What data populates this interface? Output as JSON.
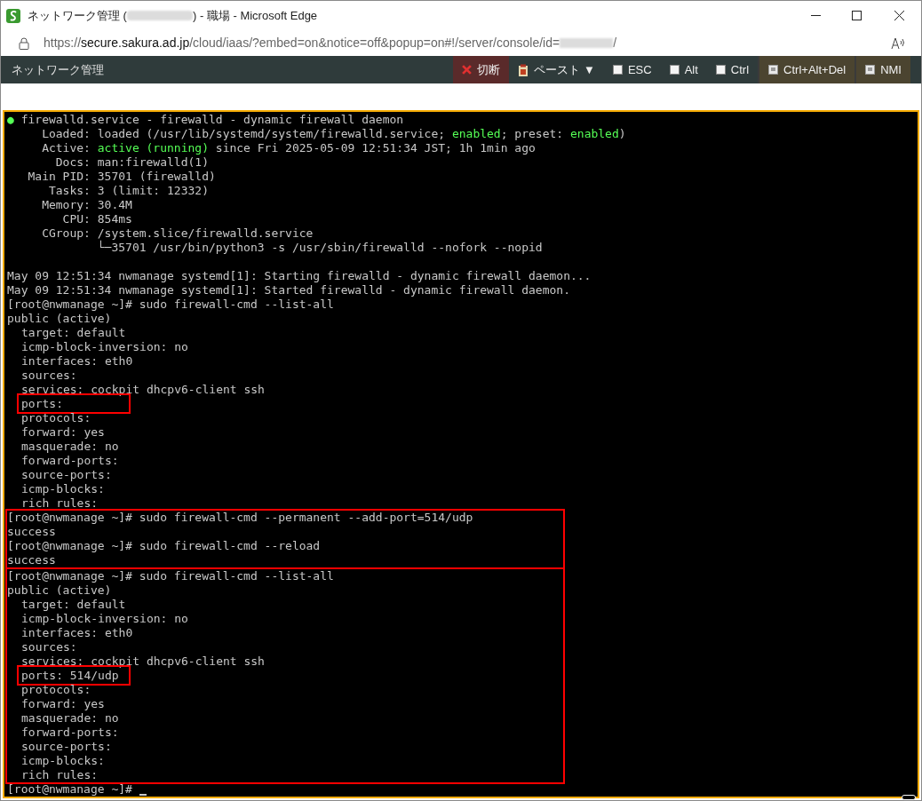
{
  "window": {
    "title_start": "ネットワーク管理 (",
    "title_end": ") - 職場 - Microsoft Edge"
  },
  "address_bar": {
    "scheme": "https://",
    "host": "secure.sakura.ad.jp",
    "path": "/cloud/iaas/?embed=on&notice=off&popup=on#!/server/console/id=",
    "tail": "/"
  },
  "toolbar": {
    "title": "ネットワーク管理",
    "controls": [
      {
        "kind": "disconnect",
        "label": "切断"
      },
      {
        "kind": "paste",
        "label": "ペースト ▼"
      },
      {
        "kind": "checkbox",
        "label": "ESC",
        "checked": false
      },
      {
        "kind": "checkbox",
        "label": "Alt",
        "checked": false
      },
      {
        "kind": "checkbox",
        "label": "Ctrl",
        "checked": false
      },
      {
        "kind": "key",
        "label": "Ctrl+Alt+Del"
      },
      {
        "kind": "key",
        "label": "NMI"
      }
    ]
  },
  "terminal": {
    "cursor": true,
    "blocks": [
      {
        "framed": false,
        "lines": [
          {
            "text": "**●** firewalld.service - firewalld - dynamic firewall daemon",
            "marked": false
          },
          {
            "text": "     Loaded: loaded (/usr/lib/systemd/system/firewalld.service; **enabled**; preset: **enabled**)",
            "marked": false
          },
          {
            "text": "     Active: **active (running)** since Fri 2025-05-09 12:51:34 JST; 1h 1min ago",
            "marked": false
          },
          {
            "text": "       Docs: man:firewalld(1)",
            "marked": false
          },
          {
            "text": "   Main PID: 35701 (firewalld)",
            "marked": false
          },
          {
            "text": "      Tasks: 3 (limit: 12332)",
            "marked": false
          },
          {
            "text": "     Memory: 30.4M",
            "marked": false
          },
          {
            "text": "        CPU: 854ms",
            "marked": false
          },
          {
            "text": "     CGroup: /system.slice/firewalld.service",
            "marked": false
          },
          {
            "text": "             └─35701 /usr/bin/python3 -s /usr/sbin/firewalld --nofork --nopid",
            "marked": false
          },
          {
            "text": "May 09 12:51:34 nwmanage systemd[1]: Starting firewalld - dynamic firewall daemon...",
            "marked": false,
            "spaced": true
          },
          {
            "text": "May 09 12:51:34 nwmanage systemd[1]: Started firewalld - dynamic firewall daemon.",
            "marked": false
          },
          {
            "text": "[root@nwmanage ~]# sudo firewall-cmd --list-all",
            "marked": false
          },
          {
            "text": "public (active)",
            "marked": false,
            "children": [
              {
                "text": "target: default",
                "marked": false
              },
              {
                "text": "icmp-block-inversion: no",
                "marked": false
              },
              {
                "text": "interfaces: eth0",
                "marked": false
              },
              {
                "text": "sources:",
                "marked": false
              },
              {
                "text": "services: cockpit dhcpv6-client ssh",
                "marked": false
              },
              {
                "text": "ports:",
                "marked": true
              },
              {
                "text": "protocols:",
                "marked": false
              },
              {
                "text": "forward: yes",
                "marked": false
              },
              {
                "text": "masquerade: no",
                "marked": false
              },
              {
                "text": "forward-ports:",
                "marked": false
              },
              {
                "text": "source-ports:",
                "marked": false
              },
              {
                "text": "icmp-blocks:",
                "marked": false
              },
              {
                "text": "rich rules:",
                "marked": false
              }
            ]
          }
        ]
      },
      {
        "framed": true,
        "lines": [
          {
            "text": "[root@nwmanage ~]# sudo firewall-cmd --permanent --add-port=514/udp",
            "marked": false
          },
          {
            "text": "success",
            "marked": false
          },
          {
            "text": "[root@nwmanage ~]# sudo firewall-cmd --reload",
            "marked": false
          },
          {
            "text": "success",
            "marked": false
          }
        ]
      },
      {
        "framed": true,
        "lines": [
          {
            "text": "[root@nwmanage ~]# sudo firewall-cmd --list-all",
            "marked": false
          },
          {
            "text": "public (active)",
            "marked": false,
            "children": [
              {
                "text": "target: default",
                "marked": false
              },
              {
                "text": "icmp-block-inversion: no",
                "marked": false
              },
              {
                "text": "interfaces: eth0",
                "marked": false
              },
              {
                "text": "sources:",
                "marked": false
              },
              {
                "text": "services: cockpit dhcpv6-client ssh",
                "marked": false
              },
              {
                "text": "ports: 514/udp",
                "marked": true
              },
              {
                "text": "protocols:",
                "marked": false
              },
              {
                "text": "forward: yes",
                "marked": false
              },
              {
                "text": "masquerade: no",
                "marked": false
              },
              {
                "text": "forward-ports:",
                "marked": false
              },
              {
                "text": "source-ports:",
                "marked": false
              },
              {
                "text": "icmp-blocks:",
                "marked": false
              },
              {
                "text": "rich rules:",
                "marked": false
              }
            ]
          }
        ]
      },
      {
        "framed": false,
        "lines": [
          {
            "text": "[root@nwmanage ~]# ",
            "marked": false
          }
        ]
      }
    ]
  }
}
